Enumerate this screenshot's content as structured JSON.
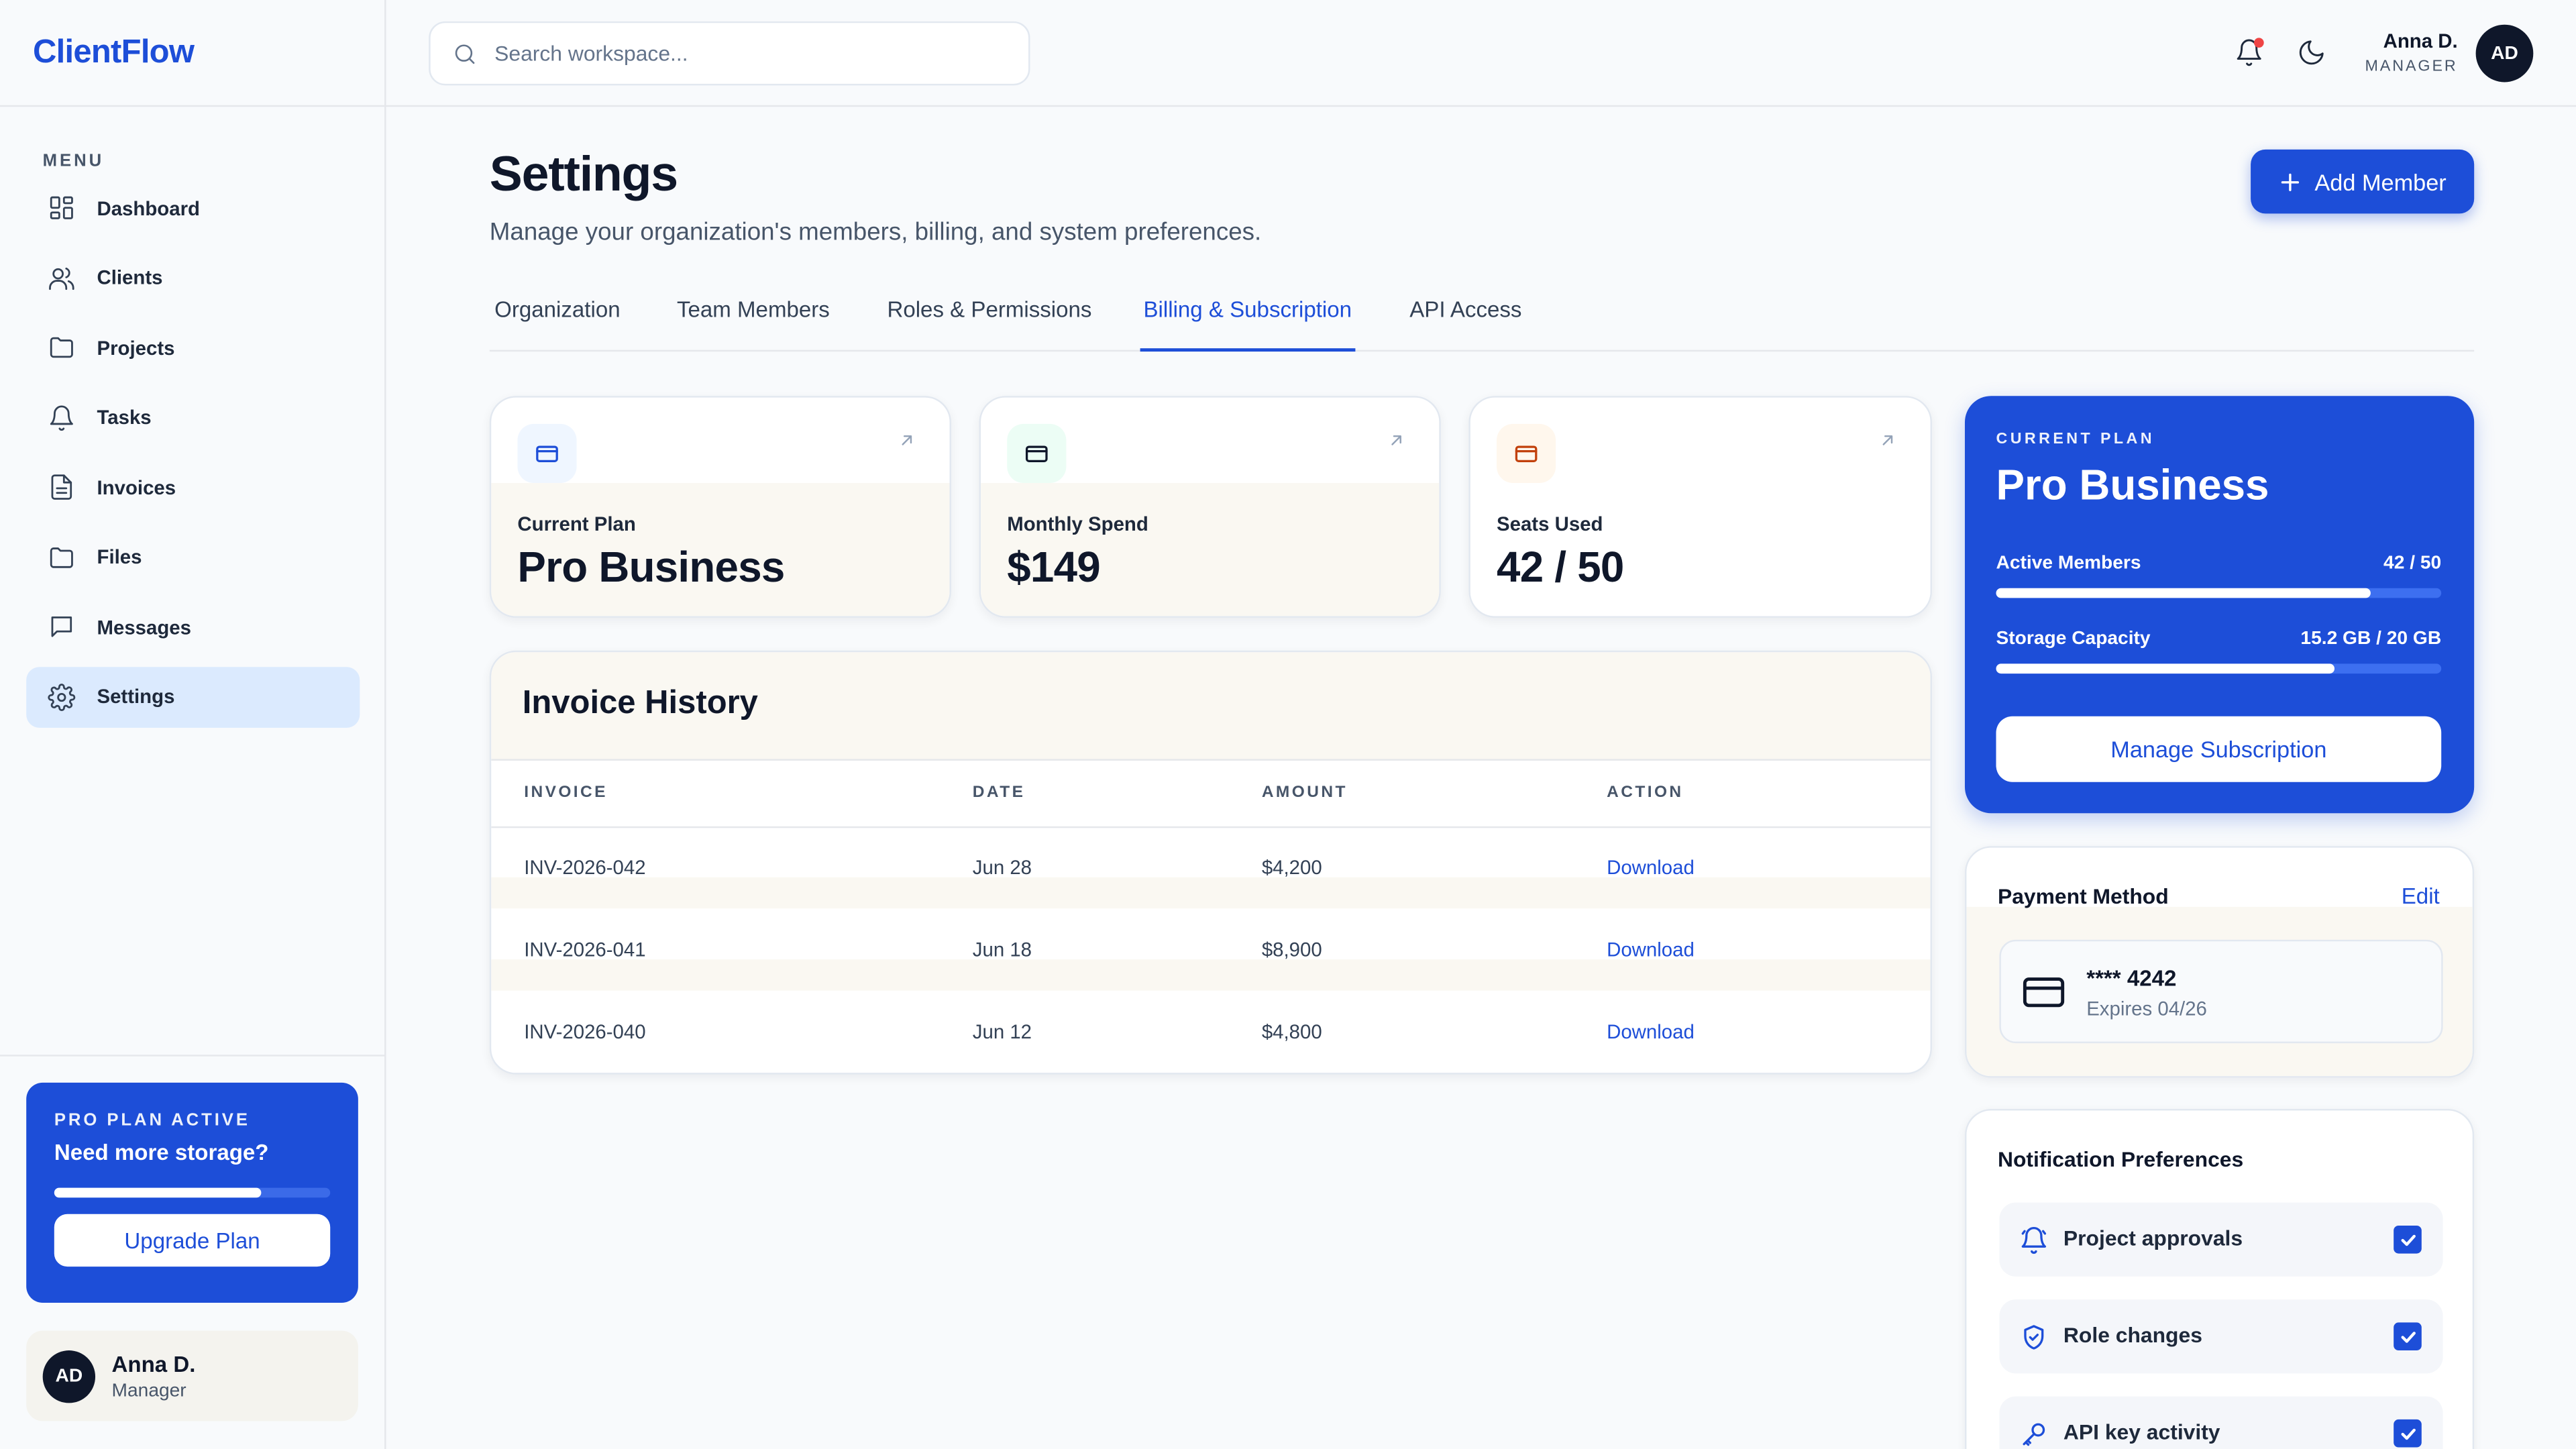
{
  "app": {
    "brand": "ClientFlow"
  },
  "sidebar": {
    "menu_label": "MENU",
    "items": [
      {
        "label": "Dashboard",
        "icon": "dashboard-icon"
      },
      {
        "label": "Clients",
        "icon": "users-icon"
      },
      {
        "label": "Projects",
        "icon": "folder-icon"
      },
      {
        "label": "Tasks",
        "icon": "bell-icon"
      },
      {
        "label": "Invoices",
        "icon": "document-icon"
      },
      {
        "label": "Files",
        "icon": "folder-icon"
      },
      {
        "label": "Messages",
        "icon": "message-icon"
      },
      {
        "label": "Settings",
        "icon": "gear-icon",
        "active": true
      }
    ],
    "promo": {
      "kicker": "PRO PLAN ACTIVE",
      "headline": "Need more storage?",
      "progress": 0.75,
      "button": "Upgrade Plan"
    },
    "user": {
      "initials": "AD",
      "name": "Anna D.",
      "role": "Manager"
    }
  },
  "topbar": {
    "search_placeholder": "Search workspace...",
    "user": {
      "name": "Anna D.",
      "role": "MANAGER",
      "initials": "AD"
    }
  },
  "page": {
    "title": "Settings",
    "subtitle": "Manage your organization's members, billing, and system preferences.",
    "add_button": "Add Member",
    "tabs": [
      "Organization",
      "Team Members",
      "Roles & Permissions",
      "Billing & Subscription",
      "API Access"
    ],
    "active_tab": "Billing & Subscription"
  },
  "stats": [
    {
      "label": "Current Plan",
      "value": "Pro Business",
      "icon": "credit-card-icon",
      "color": "#1d4ed8"
    },
    {
      "label": "Monthly Spend",
      "value": "$149",
      "icon": "credit-card-icon",
      "color": "#0f172a"
    },
    {
      "label": "Seats Used",
      "value": "42 / 50",
      "icon": "credit-card-icon",
      "color": "#c2410c"
    }
  ],
  "invoices": {
    "title": "Invoice History",
    "columns": [
      "INVOICE",
      "DATE",
      "AMOUNT",
      "ACTION"
    ],
    "rows": [
      {
        "invoice": "INV-2026-042",
        "date": "Jun 28",
        "amount": "$4,200",
        "action": "Download"
      },
      {
        "invoice": "INV-2026-041",
        "date": "Jun 18",
        "amount": "$8,900",
        "action": "Download"
      },
      {
        "invoice": "INV-2026-040",
        "date": "Jun 12",
        "amount": "$4,800",
        "action": "Download"
      }
    ]
  },
  "plan_card": {
    "kicker": "CURRENT PLAN",
    "title": "Pro Business",
    "members_label": "Active Members",
    "members_value": "42 / 50",
    "members_fraction": 0.84,
    "storage_label": "Storage Capacity",
    "storage_value": "15.2 GB / 20 GB",
    "storage_fraction": 0.76,
    "button": "Manage Subscription"
  },
  "payment": {
    "title": "Payment Method",
    "edit": "Edit",
    "card_number": "**** 4242",
    "expires": "Expires 04/26"
  },
  "notifications": {
    "title": "Notification Preferences",
    "items": [
      {
        "label": "Project approvals",
        "icon": "bell-icon",
        "checked": true
      },
      {
        "label": "Role changes",
        "icon": "shield-icon",
        "checked": true
      },
      {
        "label": "API key activity",
        "icon": "key-icon",
        "checked": true
      }
    ]
  },
  "colors": {
    "accent": "#1d4ed8",
    "text": "#0f172a",
    "muted": "#475569"
  }
}
